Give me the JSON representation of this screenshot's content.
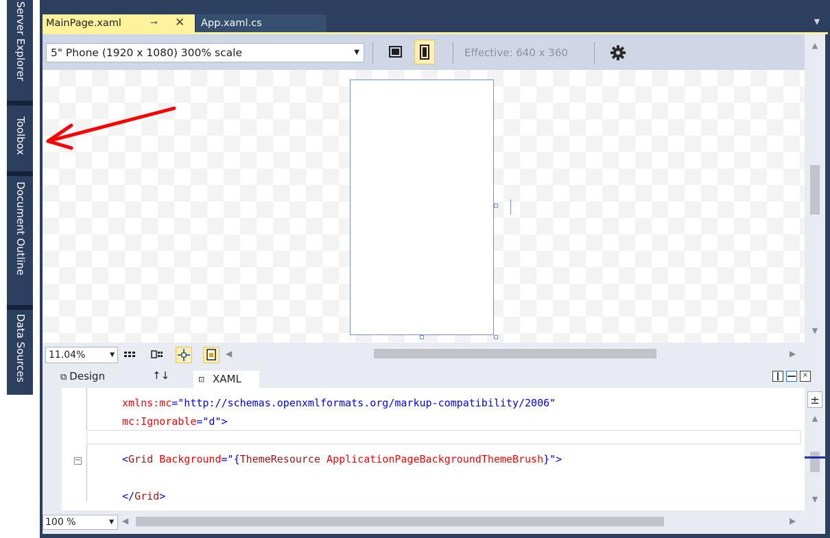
{
  "side_rail": {
    "tabs": [
      "Server Explorer",
      "Toolbox",
      "Document Outline",
      "Data Sources"
    ]
  },
  "tabs": [
    {
      "label": "MainPage.xaml",
      "active": true,
      "pin_icon": "pin-icon",
      "close_icon": "close-icon"
    },
    {
      "label": "App.xaml.cs",
      "active": false
    }
  ],
  "designer_toolbar": {
    "device": "5\" Phone (1920 x 1080) 300% scale",
    "effective_label": "Effective: 640 x 360",
    "icons": [
      "landscape-icon",
      "portrait-icon",
      "settings-gear-icon"
    ]
  },
  "zoom_bar": {
    "zoom": "11.04%",
    "icons": [
      "grid-icon",
      "snap-grid-icon",
      "snap-lines-icon",
      "artboard-icon"
    ]
  },
  "split_tabs": {
    "design": "Design",
    "swap": "↑↓",
    "xaml": "XAML"
  },
  "code": {
    "line1_attr": "xmlns:mc",
    "line1_eq": "=",
    "line1_val": "\"http://schemas.openxmlformats.org/markup-compatibility/2006\"",
    "line2_attr": "mc:Ignorable",
    "line2_eq": "=",
    "line2_val": "\"d\"",
    "line2_end": ">",
    "line3_open": "<",
    "line3_tag": "Grid",
    "line3_attr": "Background",
    "line3_eq": "=\"",
    "line3_brace1": "{",
    "line3_ext": "ThemeResource",
    "line3_res": "ApplicationPageBackgroundThemeBrush",
    "line3_brace2": "}",
    "line3_end": "\">",
    "line4_open": "</",
    "line4_tag": "Grid",
    "line4_end": ">"
  },
  "bottom_bar": {
    "zoom": "100 %"
  },
  "colors": {
    "frame": "#2d3f5e",
    "active_tab": "#fff29d",
    "annotation_arrow": "#ff0000"
  }
}
